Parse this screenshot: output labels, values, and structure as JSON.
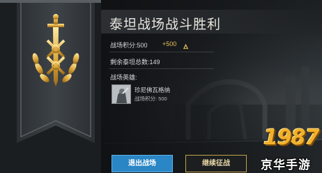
{
  "screen": {
    "title": "泰坦战场战斗胜利",
    "score_label": "战场积分:500",
    "score_gain": "+500",
    "remaining_label": "剩余泰坦总数:149",
    "heroes_label": "战场英雄:",
    "hero": {
      "name": "珍尼佛瓦格纳",
      "score": "战场积分: 500"
    }
  },
  "buttons": {
    "quit": "退出战场",
    "continue": "继续征战"
  },
  "watermark": {
    "number": "1987",
    "text": "京华手游"
  },
  "icons": {
    "score_up": "triangle-up-icon",
    "banner_emblem": "sword-laurel-emblem-icon"
  },
  "colors": {
    "gold": "#e9c15a",
    "quit_button": "#2a86c4",
    "continue_border": "#c4a24c",
    "banner": "#3a3f44"
  }
}
